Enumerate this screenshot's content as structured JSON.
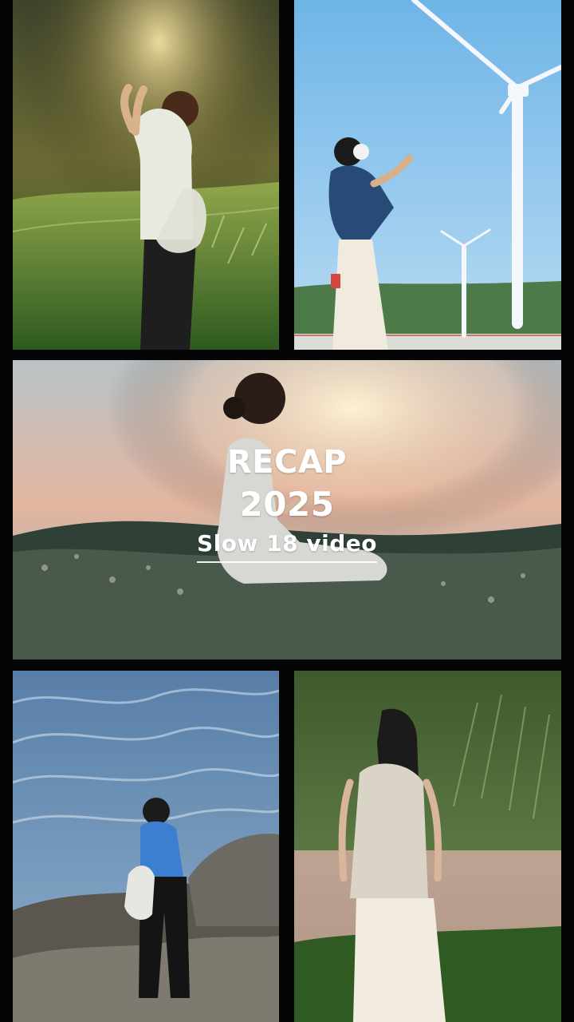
{
  "overlay": {
    "line1": "RECAP",
    "line2": "2025",
    "line3": "Slow 18 video"
  },
  "panels": {
    "top_left": "field-sunset-photo",
    "top_right": "wind-turbine-photo",
    "middle": "sunset-hill-photo",
    "bottom_left": "ocean-rocks-photo",
    "bottom_right": "pond-grass-photo"
  }
}
